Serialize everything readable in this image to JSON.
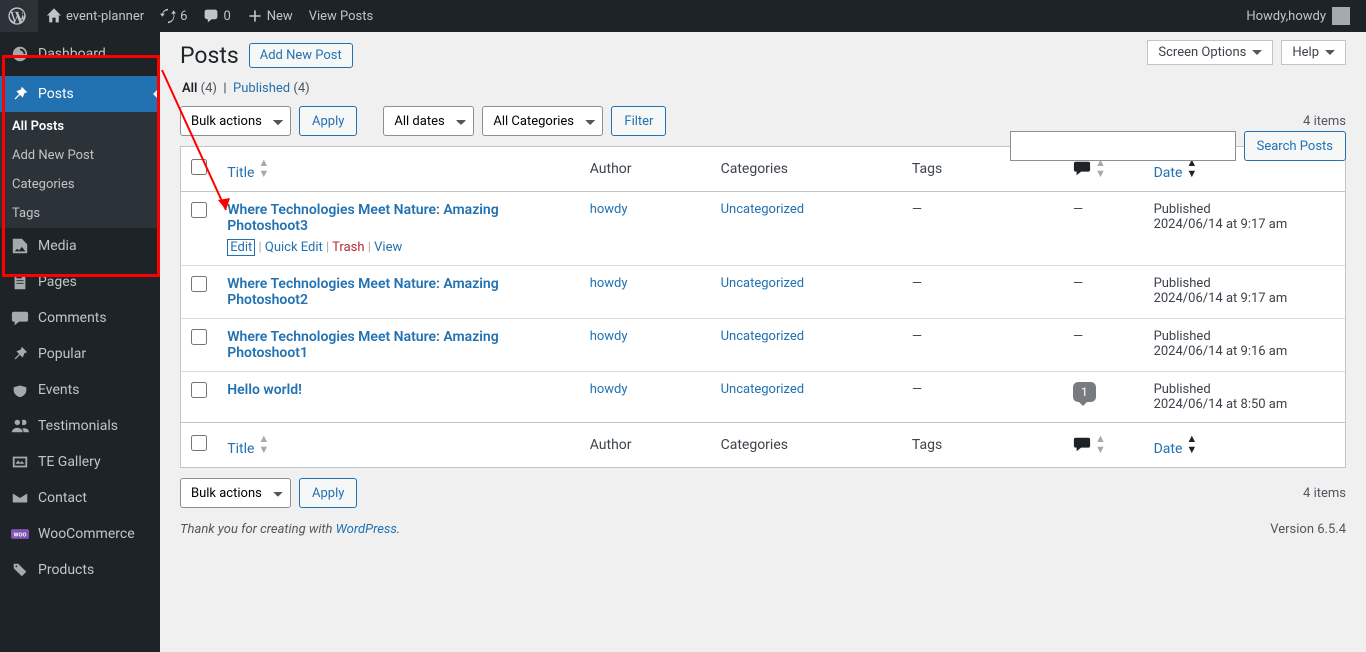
{
  "adminbar": {
    "site_name": "event-planner",
    "updates_count": "6",
    "comments_count": "0",
    "new_label": "New",
    "view_posts_label": "View Posts",
    "howdy_prefix": "Howdy, ",
    "user_name": "howdy"
  },
  "sidebar": {
    "items": [
      {
        "label": "Dashboard"
      },
      {
        "label": "Posts"
      },
      {
        "label": "Media"
      },
      {
        "label": "Pages"
      },
      {
        "label": "Comments"
      },
      {
        "label": "Popular"
      },
      {
        "label": "Events"
      },
      {
        "label": "Testimonials"
      },
      {
        "label": "TE Gallery"
      },
      {
        "label": "Contact"
      },
      {
        "label": "WooCommerce"
      },
      {
        "label": "Products"
      }
    ],
    "submenu": [
      {
        "label": "All Posts"
      },
      {
        "label": "Add New Post"
      },
      {
        "label": "Categories"
      },
      {
        "label": "Tags"
      }
    ]
  },
  "page": {
    "title": "Posts",
    "add_new": "Add New Post",
    "screen_options": "Screen Options",
    "help": "Help"
  },
  "filters": {
    "all_label": "All",
    "all_count": "(4)",
    "published_label": "Published",
    "published_count": "(4)",
    "bulk_actions": "Bulk actions",
    "apply": "Apply",
    "all_dates": "All dates",
    "all_categories": "All Categories",
    "filter_btn": "Filter",
    "search_btn": "Search Posts",
    "items_count": "4 items"
  },
  "columns": {
    "title": "Title",
    "author": "Author",
    "categories": "Categories",
    "tags": "Tags",
    "date": "Date"
  },
  "row_actions": {
    "edit": "Edit",
    "quick_edit": "Quick Edit",
    "trash": "Trash",
    "view": "View"
  },
  "posts": [
    {
      "title": "Where Technologies Meet Nature: Amazing Photoshoot3",
      "author": "howdy",
      "cat": "Uncategorized",
      "tags": "—",
      "comments": "—",
      "date_status": "Published",
      "date": "2024/06/14 at 9:17 am",
      "show_actions": true
    },
    {
      "title": "Where Technologies Meet Nature: Amazing Photoshoot2",
      "author": "howdy",
      "cat": "Uncategorized",
      "tags": "—",
      "comments": "—",
      "date_status": "Published",
      "date": "2024/06/14 at 9:17 am"
    },
    {
      "title": "Where Technologies Meet Nature: Amazing Photoshoot1",
      "author": "howdy",
      "cat": "Uncategorized",
      "tags": "—",
      "comments": "—",
      "date_status": "Published",
      "date": "2024/06/14 at 9:16 am"
    },
    {
      "title": "Hello world!",
      "author": "howdy",
      "cat": "Uncategorized",
      "tags": "—",
      "comments": "1",
      "comment_badge": true,
      "date_status": "Published",
      "date": "2024/06/14 at 8:50 am"
    }
  ],
  "footer": {
    "thanks_prefix": "Thank you for creating with ",
    "wp_link": "WordPress",
    "version": "Version 6.5.4"
  }
}
